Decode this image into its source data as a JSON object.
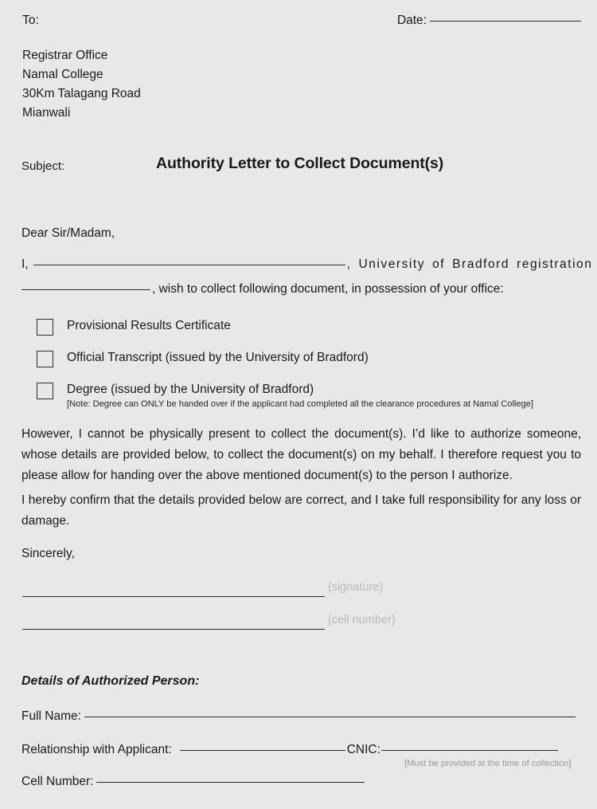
{
  "header": {
    "to_label": "To:",
    "date_label": "Date:",
    "date_value": "",
    "address_lines": [
      "Registrar Office",
      "Namal College",
      "30Km Talagang Road",
      "Mianwali"
    ]
  },
  "subject": {
    "label": "Subject:",
    "title": "Authority Letter to Collect Document(s)"
  },
  "letter": {
    "salutation": "Dear Sir/Madam,",
    "intro_line1_prefix": "I,",
    "intro_line1_suffix": ", University of Bradford registration no.",
    "intro_line2_suffix": ", wish to collect following document, in possession of your office:",
    "name_value": "",
    "registration_value": "",
    "paragraph_1": "However, I cannot be physically present to collect the document(s). I’d like to authorize someone, whose details are provided below, to collect the document(s) on my behalf. I therefore request you to please allow for handing over the above mentioned document(s) to the person I authorize.",
    "paragraph_2": "I hereby confirm that the details provided below are correct, and I take full responsibility for any loss or damage.",
    "closing": "Sincerely,"
  },
  "documents": [
    {
      "label": "Provisional Results Certificate",
      "checked": false,
      "note": ""
    },
    {
      "label": "Official Transcript (issued by the University of Bradford)",
      "checked": false,
      "note": ""
    },
    {
      "label": "Degree (issued by the University of Bradford)",
      "checked": false,
      "note": "[Note: Degree can ONLY be handed over if the applicant had completed all the clearance procedures at Namal College]"
    }
  ],
  "signature_block": {
    "signature_caption": "(signature)",
    "cell_number_caption": "(cell number)",
    "signature_value": "",
    "cell_number_value": ""
  },
  "authorized_person": {
    "heading": "Details of Authorized Person:",
    "full_name_label": "Full Name:",
    "full_name_value": "",
    "relationship_label": "Relationship with Applicant:",
    "relationship_value": "",
    "cnic_label": "CNIC:",
    "cnic_value": "",
    "cnic_note": "[Must be provided at the time of collection]",
    "cell_number_label": "Cell Number:",
    "cell_number_value": ""
  },
  "colors": {
    "page_background": "#e8e8e8",
    "text": "#1a1a1a",
    "rule": "#2b2b2b",
    "muted_caption": "#b9b9b9",
    "muted_note": "#9a9a9a"
  }
}
